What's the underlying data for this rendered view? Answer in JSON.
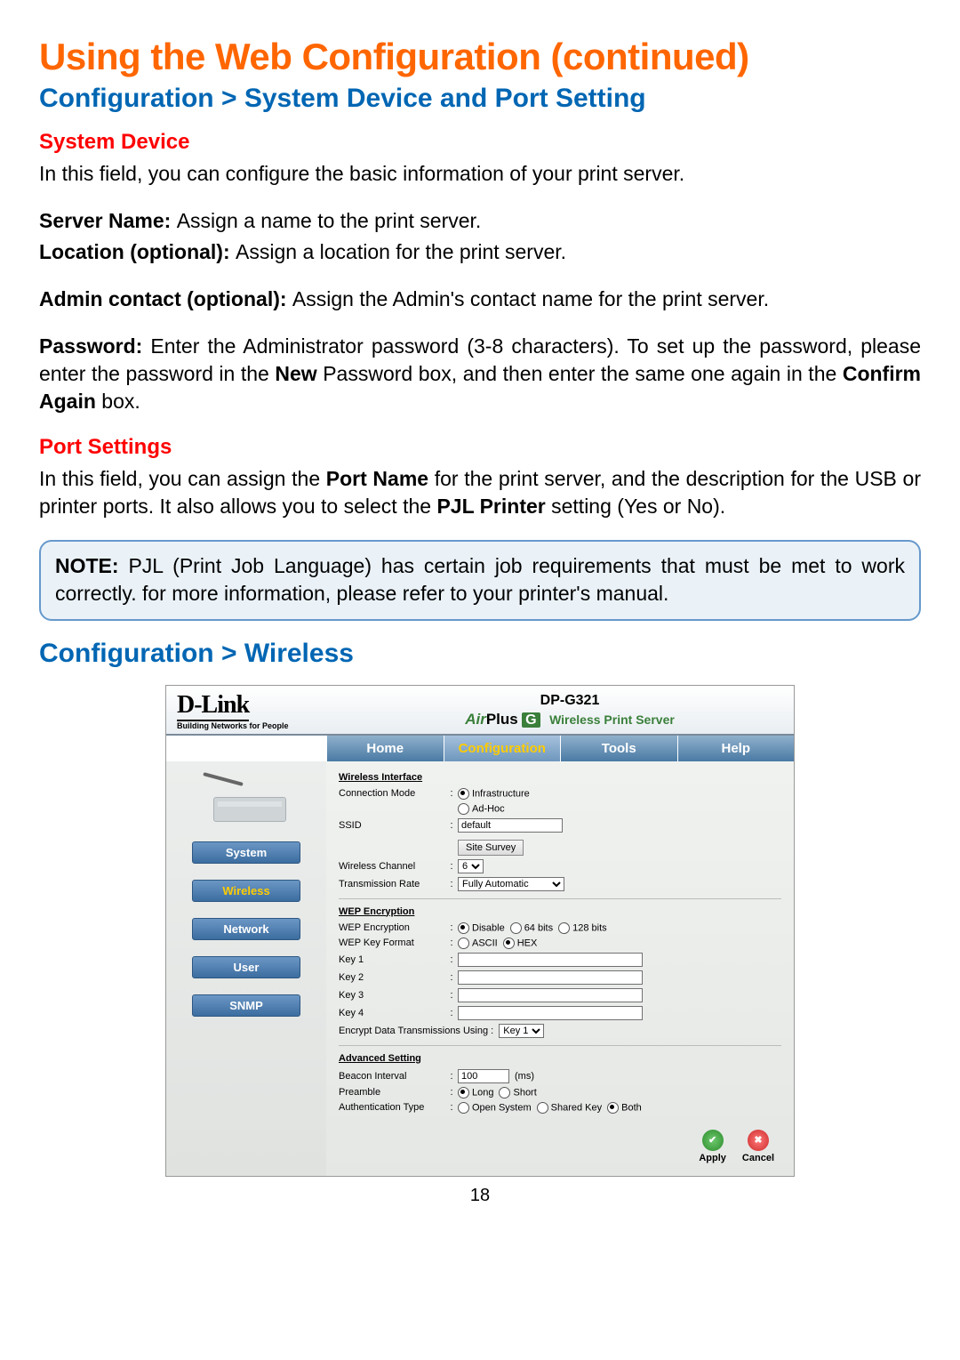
{
  "title": "Using the Web Configuration (continued)",
  "breadcrumb1": "Configuration > System Device and Port Setting",
  "sys_head": "System Device",
  "sys_intro": "In this field, you can configure the basic information of your print server.",
  "server_name_lbl": "Server Name: ",
  "server_name_txt": "Assign a name to the print server.",
  "location_lbl": "Location (optional): ",
  "location_txt": "Assign a location for the print server.",
  "admin_lbl": "Admin contact (optional): ",
  "admin_txt": "Assign the Admin's contact name for the print server.",
  "pwd_lbl": "Password: ",
  "pwd_txt_a": "Enter the Administrator password (3-8 characters). To set up the password, please enter the password in the ",
  "pwd_new": "New",
  "pwd_txt_b": " Password box, and then enter the same one again in the ",
  "pwd_confirm": "Confirm Again",
  "pwd_txt_c": " box.",
  "port_head": "Port Settings",
  "port_txt_a": "In this field, you can assign the ",
  "port_name": "Port Name",
  "port_txt_b": " for the print server, and the description for the USB or printer ports. It also allows you to select the ",
  "pjl": "PJL Printer",
  "port_txt_c": " setting (Yes or No).",
  "note_lbl": "NOTE: ",
  "note_txt": "PJL (Print Job Language) has certain job requirements that must be met to work correctly. for more information, please refer to your printer's manual.",
  "breadcrumb2": "Configuration > Wireless",
  "page_num": "18",
  "shot": {
    "logo": "D-Link",
    "logo_tag": "Building Networks for People",
    "model": "DP-G321",
    "air_a": "Air",
    "air_p": "Plus",
    "air_g": "G",
    "wps": "Wireless Print Server",
    "tabs": [
      "Home",
      "Configuration",
      "Tools",
      "Help"
    ],
    "side": [
      "System",
      "Wireless",
      "Network",
      "User",
      "SNMP"
    ],
    "grp1": "Wireless Interface",
    "conn_mode_lbl": "Connection Mode",
    "conn_opt1": "Infrastructure",
    "conn_opt2": "Ad-Hoc",
    "ssid_lbl": "SSID",
    "ssid_val": "default",
    "site_survey": "Site Survey",
    "chan_lbl": "Wireless Channel",
    "chan_val": "6",
    "rate_lbl": "Transmission Rate",
    "rate_val": "Fully Automatic",
    "grp2": "WEP Encryption",
    "wep_enc_lbl": "WEP Encryption",
    "wep_disable": "Disable",
    "wep_64": "64 bits",
    "wep_128": "128 bits",
    "wep_fmt_lbl": "WEP Key Format",
    "ascii": "ASCII",
    "hex": "HEX",
    "k1": "Key 1",
    "k2": "Key 2",
    "k3": "Key 3",
    "k4": "Key 4",
    "enc_using_lbl": "Encrypt Data Transmissions Using :",
    "enc_using_val": "Key 1",
    "grp3": "Advanced Setting",
    "beacon_lbl": "Beacon Interval",
    "beacon_val": "100",
    "ms": "(ms)",
    "preamble_lbl": "Preamble",
    "long": "Long",
    "short": "Short",
    "auth_lbl": "Authentication Type",
    "auth_open": "Open System",
    "auth_shared": "Shared Key",
    "auth_both": "Both",
    "apply": "Apply",
    "cancel": "Cancel"
  }
}
